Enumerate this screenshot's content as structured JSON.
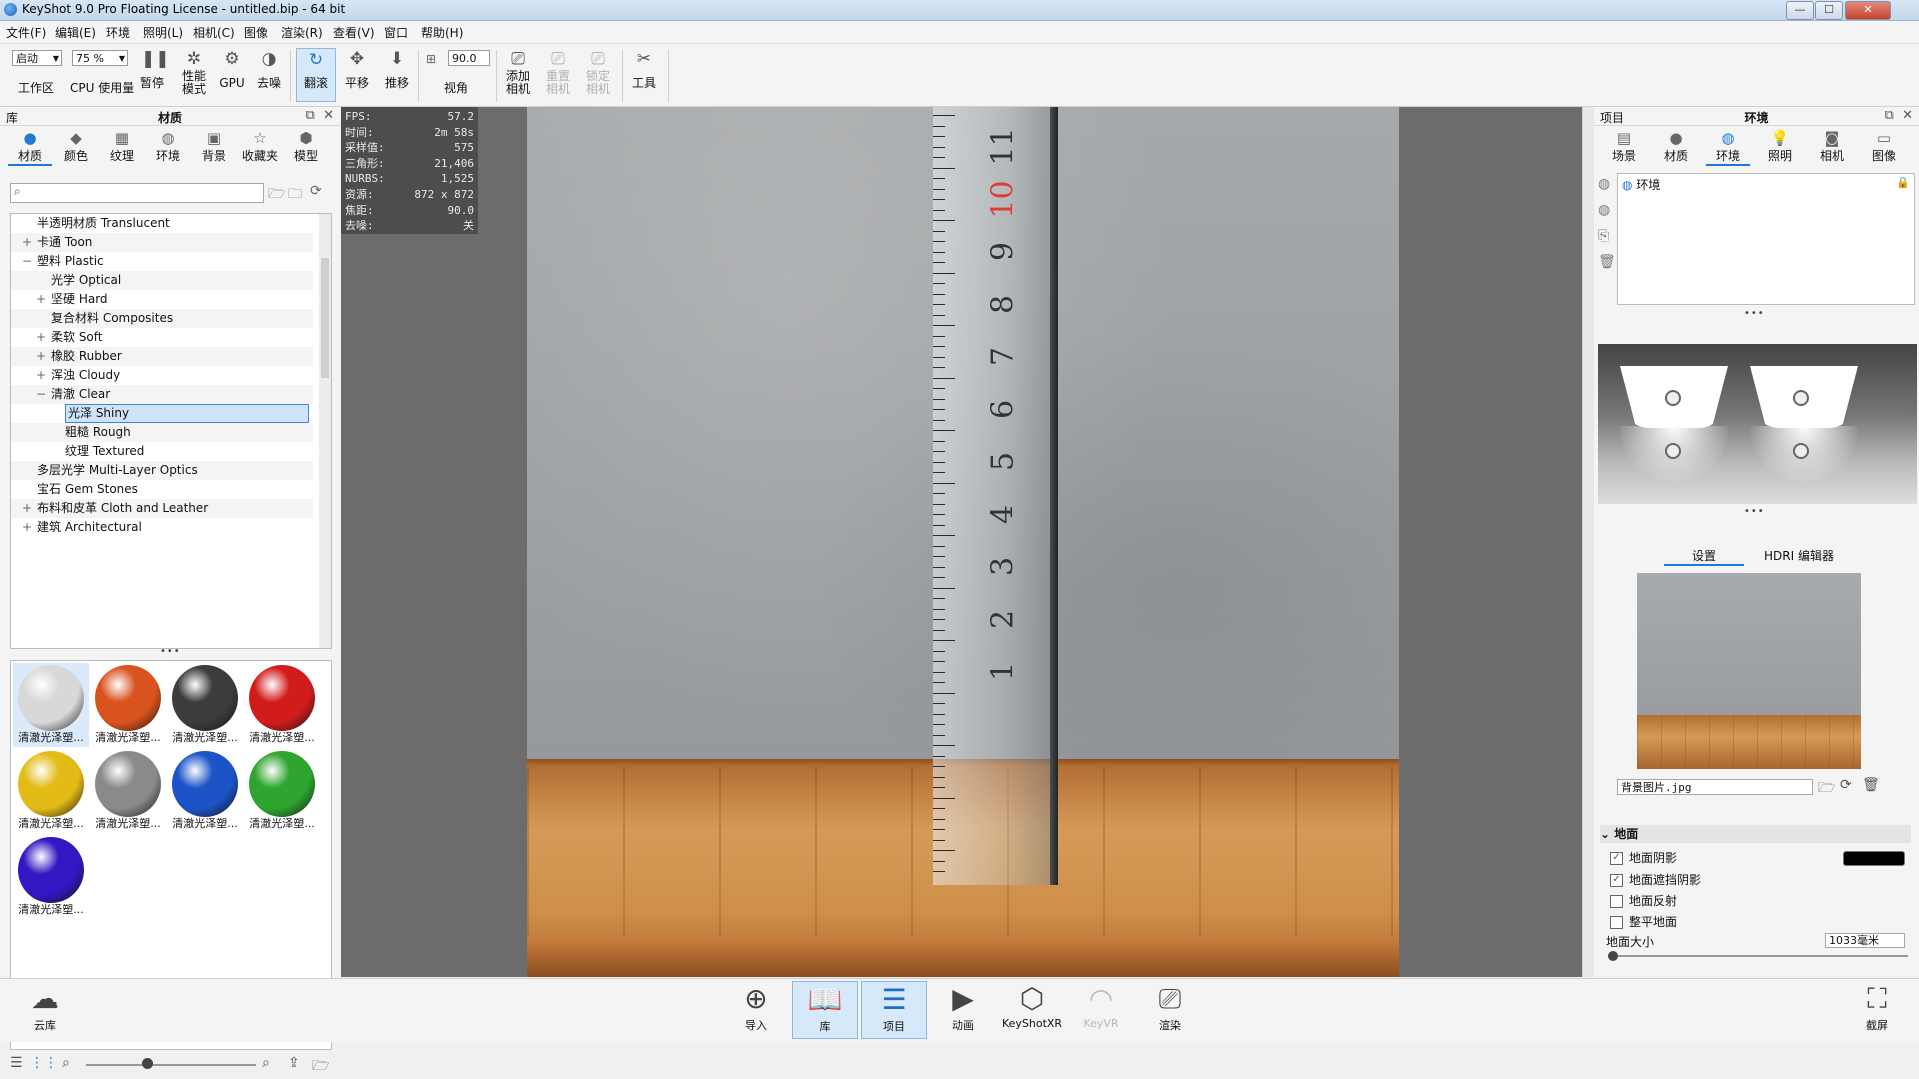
{
  "window": {
    "title": "KeyShot 9.0 Pro Floating License  - untitled.bip  - 64 bit",
    "controls": {
      "minimize": "—",
      "maximize": "☐",
      "close": "✕"
    }
  },
  "menubar": [
    "文件(F)",
    "编辑(E)",
    "环境",
    "照明(L)",
    "相机(C)",
    "图像",
    "渲染(R)",
    "查看(V)",
    "窗口",
    "帮助(H)"
  ],
  "toolbar": {
    "workspace_select": "启动",
    "workspace_label": "工作区",
    "cpu_select": "75 %",
    "cpu_label": "CPU 使用量",
    "pause": "暂停",
    "perf_mode_1": "性能",
    "perf_mode_2": "模式",
    "gpu": "GPU",
    "denoise": "去噪",
    "tumble": "翻滚",
    "pan": "平移",
    "dolly": "推移",
    "fov_value": "90.0",
    "fov_label": "视角",
    "add_camera_1": "添加",
    "add_camera_2": "相机",
    "reset_camera_1": "重置",
    "reset_camera_2": "相机",
    "lock_camera_1": "锁定",
    "lock_camera_2": "相机",
    "tools": "工具"
  },
  "library": {
    "header_left": "库",
    "header_title": "材质",
    "tabs": [
      "材质",
      "颜色",
      "纹理",
      "环境",
      "背景",
      "收藏夹",
      "模型"
    ],
    "search_placeholder": "",
    "tree": [
      {
        "label": "半透明材质 Translucent",
        "level": 1,
        "expander": ""
      },
      {
        "label": "卡通 Toon",
        "level": 1,
        "expander": "+"
      },
      {
        "label": "塑料 Plastic",
        "level": 1,
        "expander": "−"
      },
      {
        "label": "光学 Optical",
        "level": 2,
        "expander": ""
      },
      {
        "label": "坚硬 Hard",
        "level": 2,
        "expander": "+"
      },
      {
        "label": "复合材料 Composites",
        "level": 2,
        "expander": ""
      },
      {
        "label": "柔软 Soft",
        "level": 2,
        "expander": "+"
      },
      {
        "label": "橡胶 Rubber",
        "level": 2,
        "expander": "+"
      },
      {
        "label": "浑浊 Cloudy",
        "level": 2,
        "expander": "+"
      },
      {
        "label": "清澈 Clear",
        "level": 2,
        "expander": "−"
      },
      {
        "label": "光泽 Shiny",
        "level": 3,
        "expander": "",
        "selected": true
      },
      {
        "label": "粗糙 Rough",
        "level": 3,
        "expander": ""
      },
      {
        "label": "纹理 Textured",
        "level": 3,
        "expander": ""
      },
      {
        "label": "多层光学 Multi-Layer Optics",
        "level": 1,
        "expander": ""
      },
      {
        "label": "宝石 Gem Stones",
        "level": 1,
        "expander": ""
      },
      {
        "label": "布料和皮革 Cloth and Leather",
        "level": 1,
        "expander": "+"
      },
      {
        "label": "建筑 Architectural",
        "level": 1,
        "expander": "+"
      }
    ],
    "thumbnails": [
      {
        "label": "清澈光泽塑...",
        "color": "#d8d8d8"
      },
      {
        "label": "清澈光泽塑...",
        "color": "#d9531e"
      },
      {
        "label": "清澈光泽塑...",
        "color": "#3c3c3c"
      },
      {
        "label": "清澈光泽塑...",
        "color": "#d21c1c"
      },
      {
        "label": "清澈光泽塑...",
        "color": "#e3bb16"
      },
      {
        "label": "清澈光泽塑...",
        "color": "#8a8a8a"
      },
      {
        "label": "清澈光泽塑...",
        "color": "#1c54c8"
      },
      {
        "label": "清澈光泽塑...",
        "color": "#2fa52f"
      },
      {
        "label": "清澈光泽塑...",
        "color": "#3217c2"
      }
    ]
  },
  "hud": [
    {
      "k": "FPS:",
      "v": "57.2"
    },
    {
      "k": "时间:",
      "v": "2m 58s"
    },
    {
      "k": "采样值:",
      "v": "575"
    },
    {
      "k": "三角形:",
      "v": "21,406"
    },
    {
      "k": "NURBS:",
      "v": "1,525"
    },
    {
      "k": "资源:",
      "v": "872 x 872"
    },
    {
      "k": "焦距:",
      "v": "90.0"
    },
    {
      "k": "去噪:",
      "v": "关"
    }
  ],
  "ruler_numbers": [
    "11",
    "10",
    "9",
    "8",
    "7",
    "6",
    "5",
    "4",
    "3",
    "2",
    "1"
  ],
  "project": {
    "header_left": "项目",
    "header_title": "环境",
    "tabs": [
      "场景",
      "材质",
      "环境",
      "照明",
      "相机",
      "图像"
    ],
    "env_item": "环境",
    "subtabs": [
      "设置",
      "HDRI 编辑器"
    ],
    "bg_file": "背景图片.jpg",
    "ground": {
      "title": "地面",
      "options": [
        {
          "label": "地面阴影",
          "checked": true
        },
        {
          "label": "地面遮挡阴影",
          "checked": true
        },
        {
          "label": "地面反射",
          "checked": false
        },
        {
          "label": "整平地面",
          "checked": false
        }
      ],
      "size_label": "地面大小",
      "size_value": "1033毫米"
    }
  },
  "bottombar": {
    "cloud": "云库",
    "import": "导入",
    "library": "库",
    "project": "项目",
    "animation": "动画",
    "keyshotxr": "KeyShotXR",
    "keyvr": "KeyVR",
    "render": "渲染",
    "screenshot": "截屏"
  }
}
